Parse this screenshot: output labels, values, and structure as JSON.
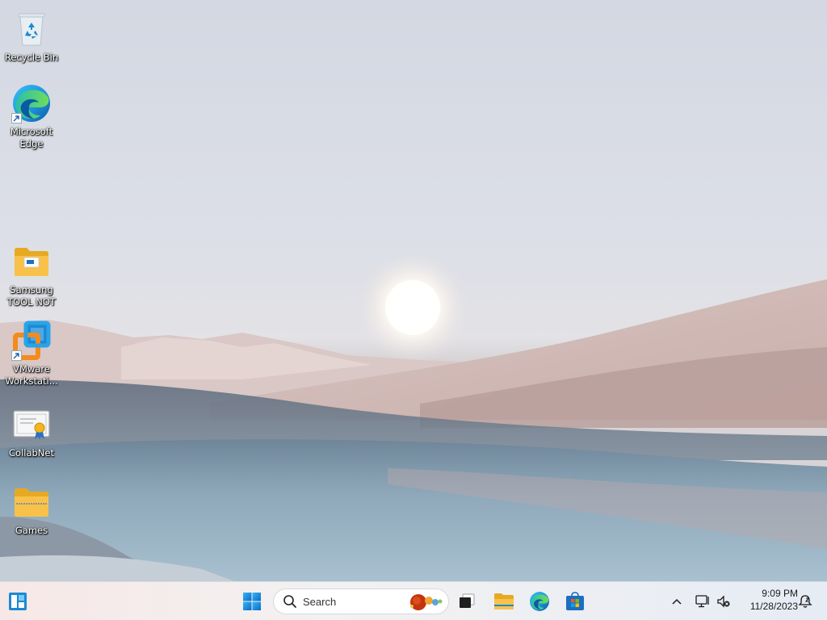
{
  "desktop": {
    "icons": [
      {
        "label": "Recycle Bin",
        "icon": "recycle-bin-icon"
      },
      {
        "label": "Microsoft Edge",
        "icon": "edge-icon",
        "shortcut": true
      },
      {
        "label": "Samsung TOOL NOT",
        "icon": "folder-icon"
      },
      {
        "label": "VMware Workstati...",
        "icon": "vmware-icon",
        "shortcut": true
      },
      {
        "label": "CollabNet",
        "icon": "certificate-icon"
      },
      {
        "label": "Games",
        "icon": "zip-folder-icon"
      }
    ]
  },
  "taskbar": {
    "widgets_icon": "widgets-icon",
    "start_icon": "windows-start-icon",
    "search": {
      "placeholder": "Search"
    },
    "pinned": [
      "task-view-icon",
      "file-explorer-icon",
      "edge-icon",
      "microsoft-store-icon"
    ],
    "tray": {
      "overflow_icon": "chevron-up-icon",
      "network_icon": "monitor-network-icon",
      "volume_icon": "volume-muted-icon",
      "notification_icon": "notification-bell-icon"
    },
    "clock": {
      "time": "9:09 PM",
      "date": "11/28/2023"
    }
  },
  "colors": {
    "accent": "#0078d4",
    "folder": "#f8c24a",
    "taskbar": "#f3f1f2"
  }
}
